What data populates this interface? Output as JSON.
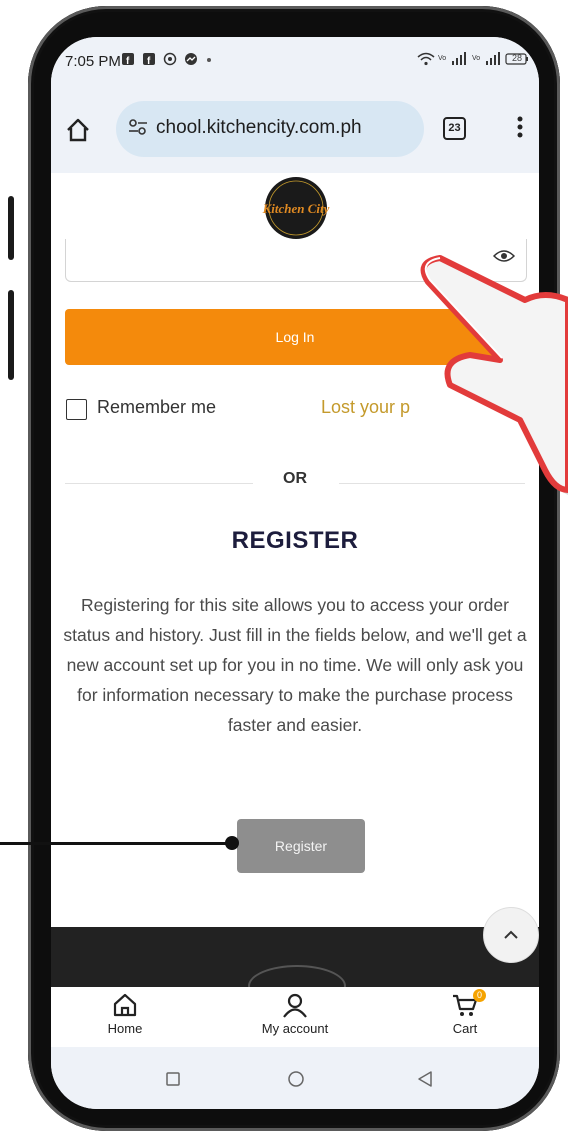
{
  "status_bar": {
    "time": "7:05 PM",
    "icons": [
      "facebook-icon",
      "facebook-icon",
      "viber-icon",
      "messenger-icon",
      "dot-icon"
    ],
    "right_icons": [
      "wifi-icon",
      "signal-icon",
      "signal-icon",
      "battery-icon"
    ],
    "battery": "28"
  },
  "browser": {
    "url": "chool.kitchencity.com.ph",
    "tab_count": "23"
  },
  "logo": {
    "text": "Kitchen City"
  },
  "login": {
    "button_label": "Log In",
    "remember_label": "Remember me",
    "lost_password": "Lost your p"
  },
  "divider": {
    "or_label": "OR"
  },
  "register": {
    "title": "REGISTER",
    "description": "Registering for this site allows you to access your order status and history. Just fill in the fields below, and we'll get a new account set up for you in no time. We will only ask you for information necessary to make the purchase process faster and easier.",
    "button_label": "Register"
  },
  "bottom_nav": {
    "items": [
      {
        "label": "Home",
        "icon": "home-icon"
      },
      {
        "label": "My account",
        "icon": "user-icon"
      },
      {
        "label": "Cart",
        "icon": "cart-icon"
      }
    ],
    "cart_badge": "0"
  },
  "colors": {
    "accent": "#f48a0c",
    "register_button": "#8e8e8e",
    "title": "#1d1d3d",
    "lost_link": "#c49a2c"
  }
}
